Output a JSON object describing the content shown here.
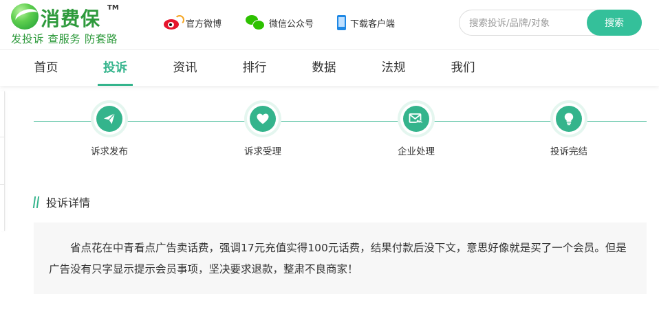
{
  "brand": {
    "name": "消费保",
    "tm": "TM",
    "slogan": "发投诉 查服务 防套路",
    "colors": {
      "primary": "#34b48c",
      "logo": "#2e9a3c"
    }
  },
  "header": {
    "links": [
      {
        "label": "官方微博",
        "icon": "weibo-icon"
      },
      {
        "label": "微信公众号",
        "icon": "wechat-icon"
      },
      {
        "label": "下载客户端",
        "icon": "mobile-phone-icon"
      }
    ],
    "search": {
      "placeholder": "搜索投诉/品牌/对象",
      "button": "搜索"
    }
  },
  "nav": {
    "items": [
      "首页",
      "投诉",
      "资讯",
      "排行",
      "数据",
      "法规",
      "我们"
    ],
    "active": "投诉"
  },
  "steps": [
    {
      "label": "诉求发布",
      "icon": "paper-plane-icon"
    },
    {
      "label": "诉求受理",
      "icon": "heart-icon"
    },
    {
      "label": "企业处理",
      "icon": "envelope-reply-icon"
    },
    {
      "label": "投诉完结",
      "icon": "lightbulb-icon"
    }
  ],
  "detail": {
    "title": "投诉详情",
    "text": "省点花在中青看点广告卖话费，强调17元充值实得100元话费，结果付款后没下文，意思好像就是买了一个会员。但是广告没有只字显示提示会员事项，坚决要求退款，整肃不良商家！"
  }
}
